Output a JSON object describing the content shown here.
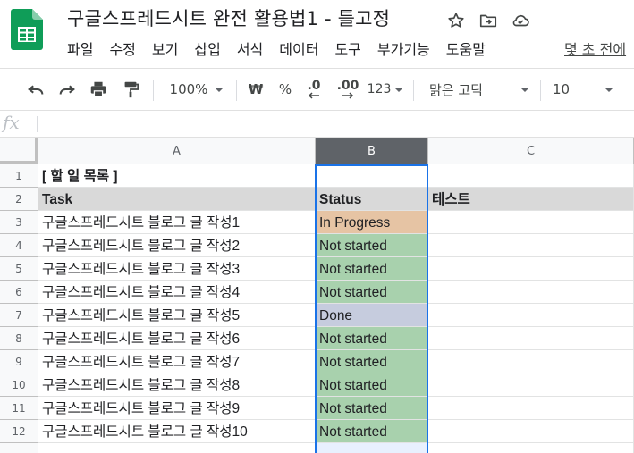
{
  "app": {
    "document_title": "구글스프레드시트 완전 활용법1 - 틀고정",
    "icons": [
      "star-icon",
      "move-to-folder-icon",
      "cloud-status-icon"
    ]
  },
  "menu": {
    "items": [
      "파일",
      "수정",
      "보기",
      "삽입",
      "서식",
      "데이터",
      "도구",
      "부가기능",
      "도움말"
    ],
    "last_edit": "몇 초 전에"
  },
  "toolbar": {
    "zoom": "100%",
    "currency": "₩",
    "percent": "%",
    "decrease_decimal": ".0",
    "increase_decimal": ".00",
    "more_formats": "123",
    "font": "맑은 고딕",
    "font_size": "10"
  },
  "formula_bar": {
    "label": "fx",
    "value": ""
  },
  "sheet": {
    "columns": [
      "A",
      "B",
      "C"
    ],
    "selected_column": "B",
    "rows": [
      {
        "num": "1",
        "a": "[ 할 일 목록 ]",
        "b": "",
        "c": ""
      },
      {
        "num": "2",
        "a": "Task",
        "b": "Status",
        "c": "테스트"
      },
      {
        "num": "3",
        "a": "구글스프레드시트 블로그 글 작성1",
        "b": "In Progress",
        "c": ""
      },
      {
        "num": "4",
        "a": "구글스프레드시트 블로그 글 작성2",
        "b": "Not started",
        "c": ""
      },
      {
        "num": "5",
        "a": "구글스프레드시트 블로그 글 작성3",
        "b": "Not started",
        "c": ""
      },
      {
        "num": "6",
        "a": "구글스프레드시트 블로그 글 작성4",
        "b": "Not started",
        "c": ""
      },
      {
        "num": "7",
        "a": "구글스프레드시트 블로그 글 작성5",
        "b": "Done",
        "c": ""
      },
      {
        "num": "8",
        "a": "구글스프레드시트 블로그 글 작성6",
        "b": "Not started",
        "c": ""
      },
      {
        "num": "9",
        "a": "구글스프레드시트 블로그 글 작성7",
        "b": "Not started",
        "c": ""
      },
      {
        "num": "10",
        "a": "구글스프레드시트 블로그 글 작성8",
        "b": "Not started",
        "c": ""
      },
      {
        "num": "11",
        "a": "구글스프레드시트 블로그 글 작성9",
        "b": "Not started",
        "c": ""
      },
      {
        "num": "12",
        "a": "구글스프레드시트 블로그 글 작성10",
        "b": "Not started",
        "c": ""
      }
    ]
  },
  "colors": {
    "header_row_fill": "#d9d9d9",
    "in_progress_fill": "#e6c4a4",
    "not_started_fill": "#a8d1ad",
    "done_fill": "#c6ccde",
    "selection_border": "#1a73e8",
    "sheets_green": "#0f9d58"
  }
}
